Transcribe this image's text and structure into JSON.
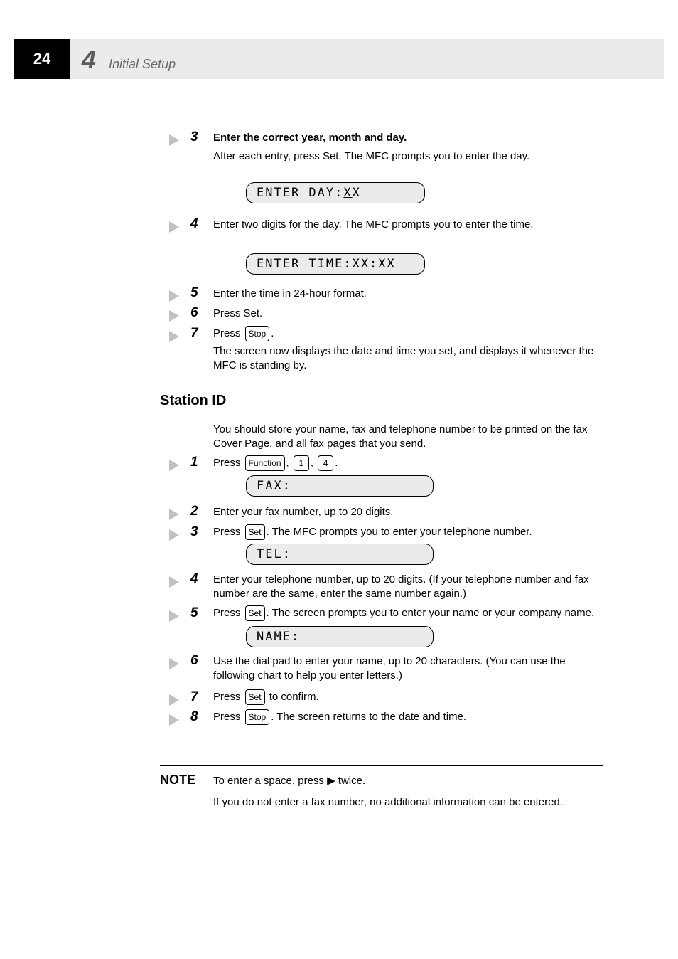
{
  "page_number": "24",
  "chapter": {
    "number": "4",
    "title": "Initial Setup"
  },
  "s3_title": "Enter the correct year, month and day.",
  "s3_text": "After each entry, press Set. The MFC prompts you to enter the day.",
  "s4_text": "Enter two digits for the day. The MFC prompts you to enter the time.",
  "s5_text": "Enter the time in 24-hour format.",
  "s6_text": "Press Set.",
  "s7_text": "Press Stop.",
  "s7_tail": "The screen now displays the date and time you set, and displays it whenever the MFC is standing by.",
  "lcd1_a": "ENTER DAY:",
  "lcd1_b": "X",
  "lcd1_c": "X",
  "lcd2": "ENTER TIME:XX:XX",
  "lcd3": "FAX:",
  "lcd4": "TEL:",
  "lcd5": "NAME:",
  "number": "3",
  "n4": "4",
  "n5": "5",
  "n6": "6",
  "n7": "7",
  "section2": "Station ID",
  "t1_text": "Press Function, 1, 4.",
  "t2_text": "Enter your fax number, up to 20 digits.",
  "t3_text": "Press Set. The MFC prompts you to enter your telephone number.",
  "t4_text": "Enter your telephone number, up to 20 digits. (If your telephone number and fax number are the same, enter the same number again.)",
  "t5_text": "Press Set. The screen prompts you to enter your name or your company name.",
  "t6_text": "Use the dial pad to enter your name, up to 20 characters. (You can use the following chart to help you enter letters.)",
  "t7_text": "Press Set to confirm.",
  "t8_text": "Press Stop. The screen returns to the date and time.",
  "tn1": "1",
  "tn2": "2",
  "tn3": "3",
  "tn4": "4",
  "tn5": "5",
  "tn6": "6",
  "tn7": "7",
  "tn8": "8",
  "key_function": "Function",
  "key_1": "1",
  "key_4": "4",
  "key_set": "Set",
  "key_stop": "Stop",
  "section3_title": "NOTE",
  "section3_text": "To enter a space, press ▶ twice.",
  "section3_tail": "If you do not enter a fax number, no additional information can be entered."
}
